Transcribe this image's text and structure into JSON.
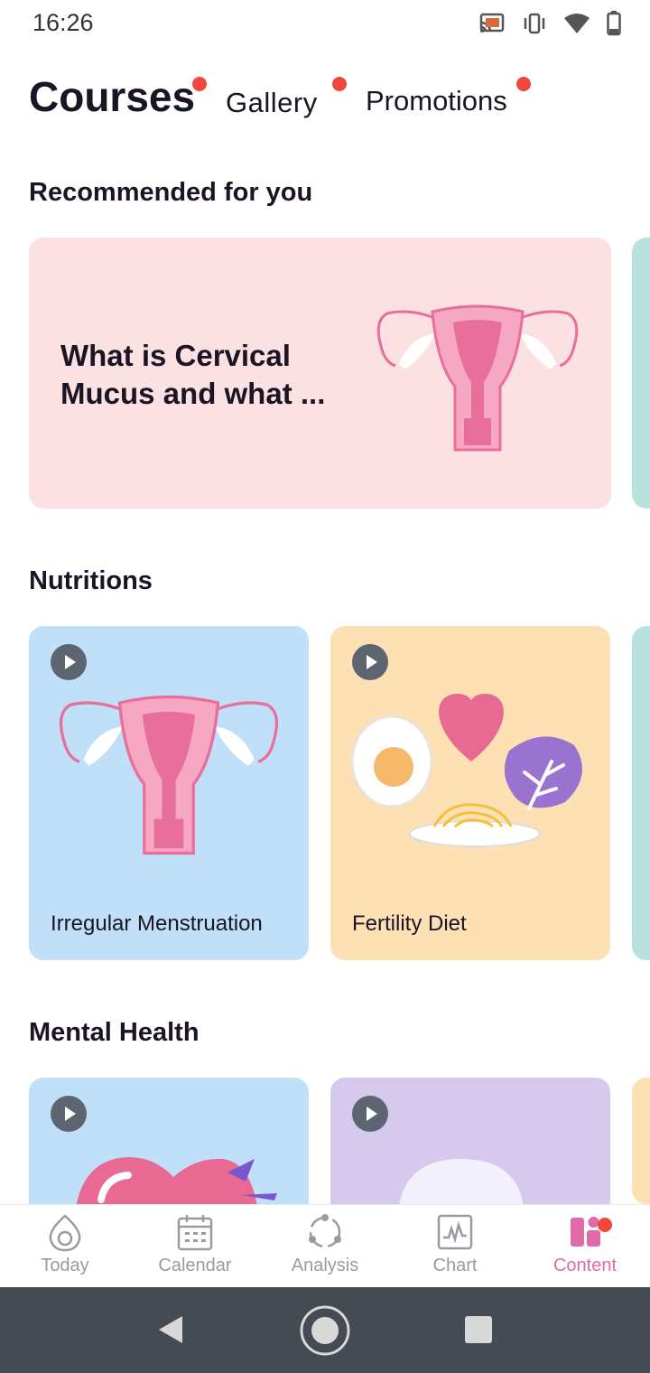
{
  "status_bar": {
    "time": "16:26",
    "icons": [
      "cast-icon",
      "vibrate-icon",
      "wifi-icon",
      "battery-icon"
    ]
  },
  "top_tabs": [
    {
      "label": "Courses",
      "active": true,
      "has_badge": true
    },
    {
      "label": "Gallery",
      "active": false,
      "has_badge": true
    },
    {
      "label": "Promotions",
      "active": false,
      "has_badge": true
    }
  ],
  "sections": {
    "recommended": {
      "title": "Recommended for you",
      "cards": [
        {
          "title": "What is Cervical Mucus and what ...",
          "background": "#fce1e3",
          "image": "uterus-illustration"
        }
      ]
    },
    "nutritions": {
      "title": "Nutritions",
      "cards": [
        {
          "title": "Irregular Menstruation",
          "background": "#bfe0f8",
          "image": "uterus-illustration",
          "video": true
        },
        {
          "title": "Fertility Diet",
          "background": "#fde0b4",
          "image": "food-illustration",
          "video": true
        }
      ]
    },
    "mental_health": {
      "title": "Mental Health",
      "cards": [
        {
          "title": "",
          "background": "#bfe0f8",
          "image": "heart-illustration",
          "video": true
        },
        {
          "title": "",
          "background": "#d5c9ee",
          "image": "circle-illustration",
          "video": true
        }
      ]
    }
  },
  "bottom_nav": [
    {
      "label": "Today",
      "icon": "egg-icon",
      "active": false
    },
    {
      "label": "Calendar",
      "icon": "calendar-icon",
      "active": false
    },
    {
      "label": "Analysis",
      "icon": "analysis-icon",
      "active": false
    },
    {
      "label": "Chart",
      "icon": "chart-icon",
      "active": false
    },
    {
      "label": "Content",
      "icon": "content-icon",
      "active": true,
      "has_badge": true
    }
  ],
  "colors": {
    "accent": "#e06aa8",
    "badge": "#f0473c",
    "text": "#1b1424"
  }
}
